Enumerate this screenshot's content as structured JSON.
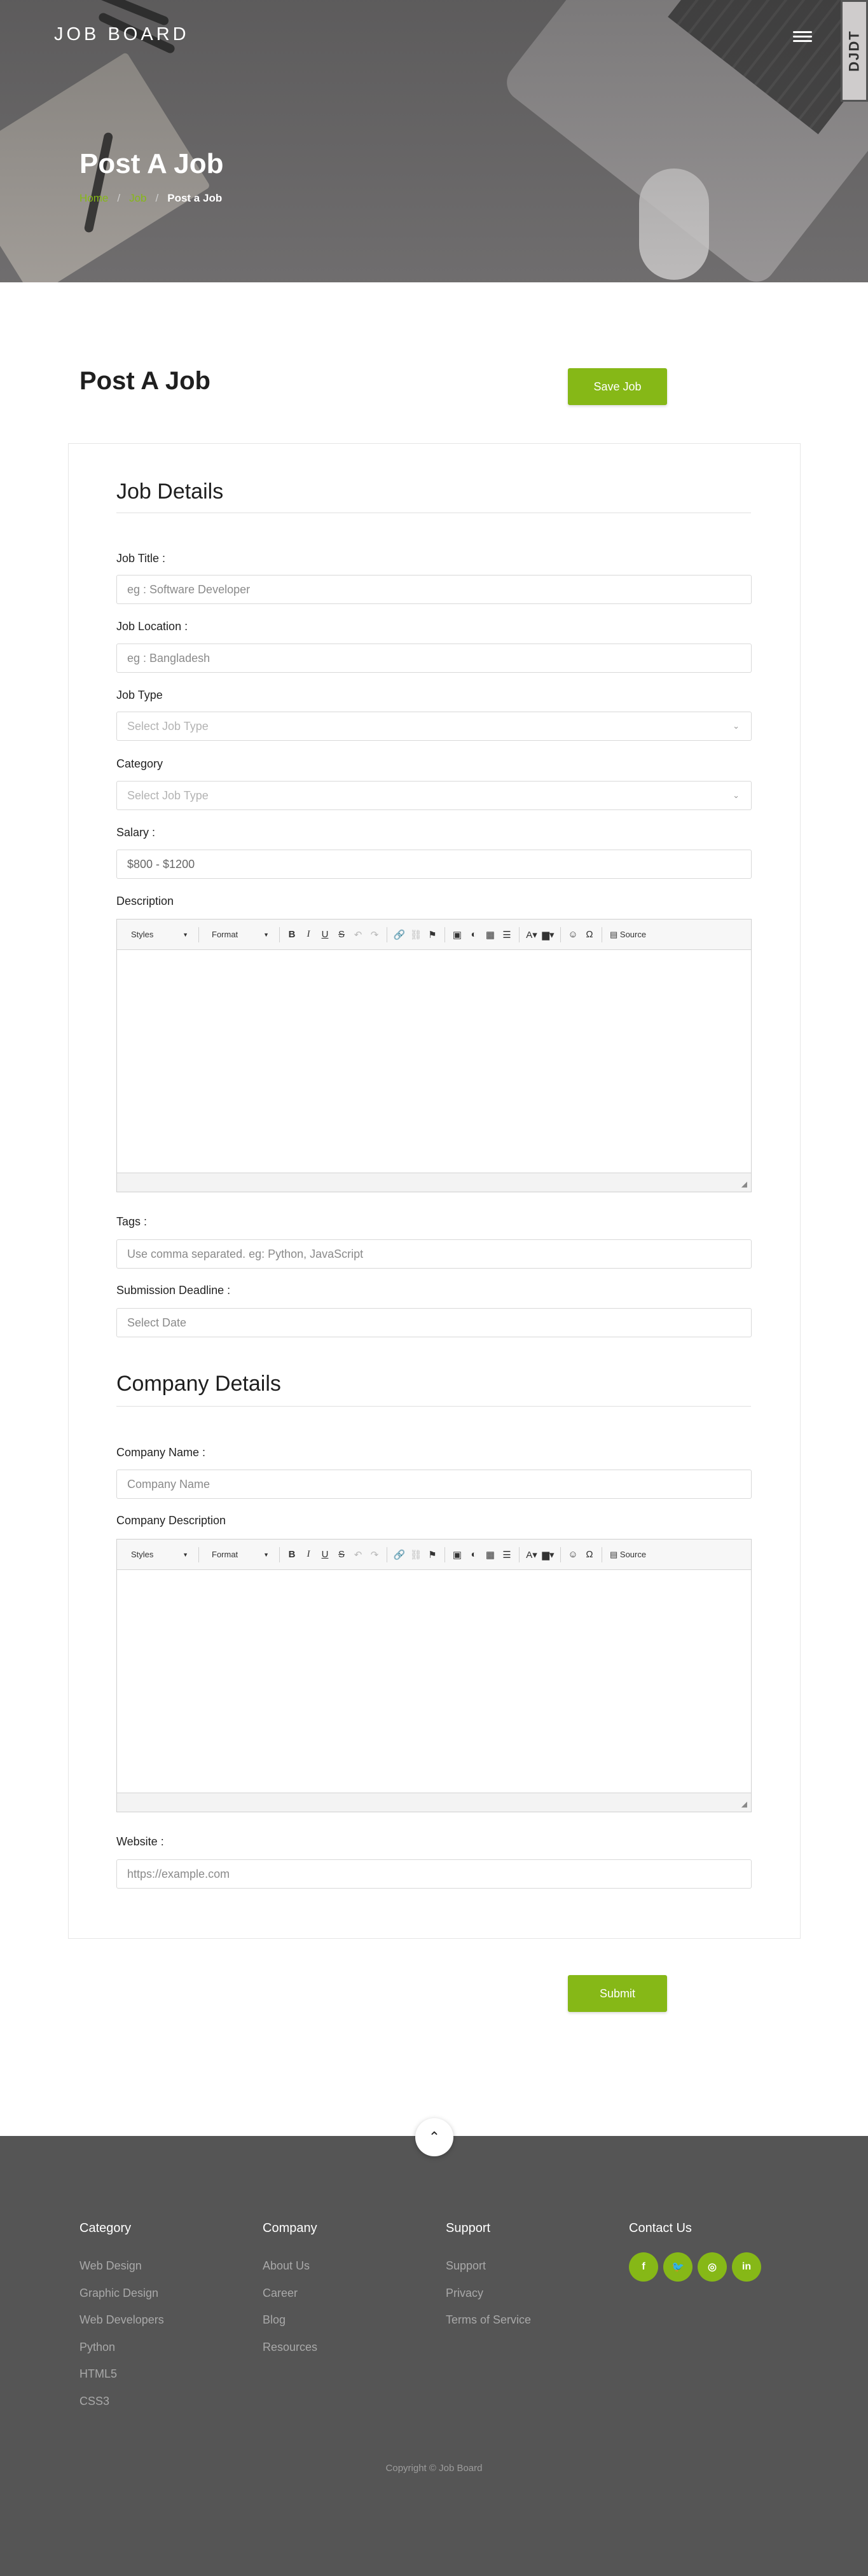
{
  "header": {
    "brand": "JOB BOARD",
    "side_badge": "DJDT",
    "title": "Post A Job",
    "breadcrumb": [
      "Home",
      "Job",
      "Post a Job"
    ]
  },
  "page": {
    "heading": "Post A Job",
    "save_button": "Save Job"
  },
  "job_details": {
    "title": "Job Details",
    "job_title": {
      "label": "Job Title :",
      "placeholder": "eg : Software Developer"
    },
    "job_location": {
      "label": "Job Location :",
      "placeholder": "eg : Bangladesh"
    },
    "job_type": {
      "label": "Job Type",
      "selected": "Select Job Type"
    },
    "category": {
      "label": "Category",
      "selected": "Select Job Type"
    },
    "salary": {
      "label": "Salary :",
      "value": "$800 - $1200"
    },
    "description": {
      "label": "Description"
    },
    "tags": {
      "label": "Tags :",
      "placeholder": "Use comma separated. eg: Python, JavaScript"
    },
    "deadline": {
      "label": "Submission Deadline :",
      "placeholder": "Select Date"
    }
  },
  "editor": {
    "styles": "Styles",
    "format": "Format",
    "bold": "B",
    "italic": "I",
    "underline": "U",
    "strike": "S",
    "source": "Source"
  },
  "company_details": {
    "title": "Company Details",
    "name": {
      "label": "Company Name :",
      "placeholder": "Company Name"
    },
    "description": {
      "label": "Company Description"
    },
    "website": {
      "label": "Website :",
      "placeholder": "https://example.com"
    }
  },
  "submit_button": "Submit",
  "footer": {
    "category": {
      "title": "Category",
      "links": [
        "Web Design",
        "Graphic Design",
        "Web Developers",
        "Python",
        "HTML5",
        "CSS3"
      ]
    },
    "company": {
      "title": "Company",
      "links": [
        "About Us",
        "Career",
        "Blog",
        "Resources"
      ]
    },
    "support": {
      "title": "Support",
      "links": [
        "Support",
        "Privacy",
        "Terms of Service"
      ]
    },
    "contact": {
      "title": "Contact Us"
    },
    "socials": [
      "facebook-icon",
      "twitter-icon",
      "instagram-icon",
      "linkedin-icon"
    ],
    "copyright": "Copyright © Job Board"
  },
  "colors": {
    "accent": "#86b817",
    "footer_bg": "#555555",
    "hero_bg": "#6e6c6d"
  }
}
